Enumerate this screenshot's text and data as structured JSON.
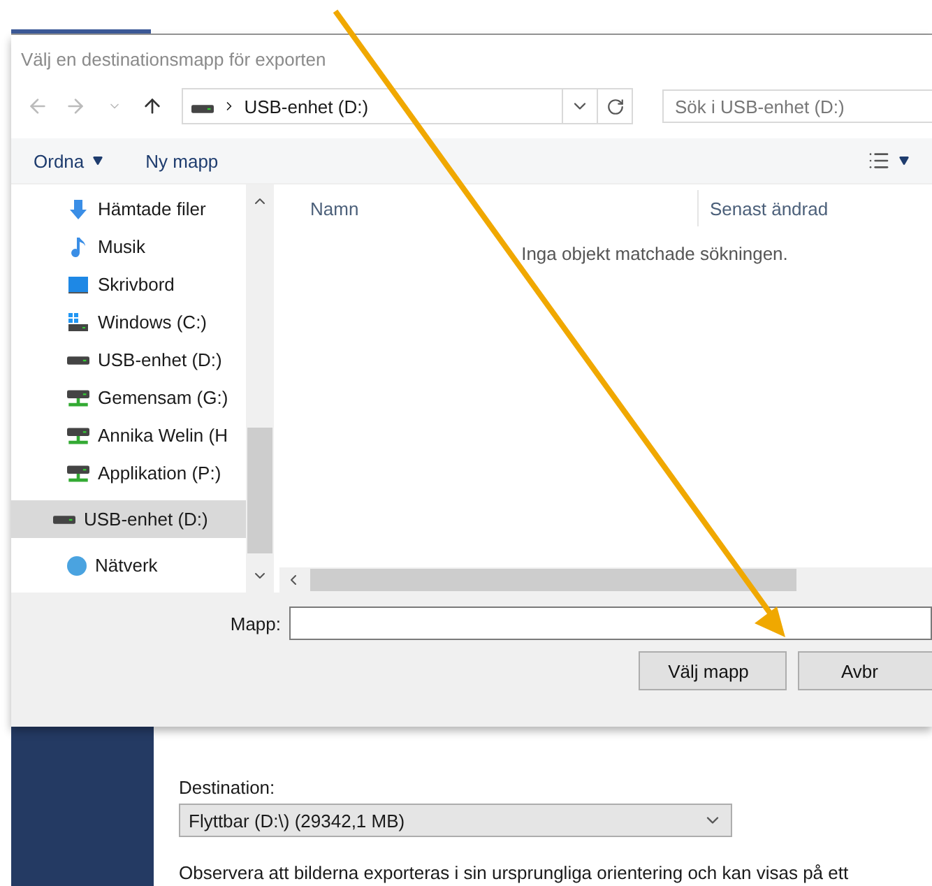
{
  "dialog": {
    "title": "Välj en destinationsmapp för exporten",
    "address": {
      "path": "USB-enhet (D:)"
    },
    "search": {
      "placeholder": "Sök i USB-enhet (D:)"
    },
    "toolbar": [
      "Ordna",
      "Ny mapp"
    ],
    "sidebar": {
      "items": [
        {
          "label": "Hämtade filer",
          "kind": "download",
          "selected": false
        },
        {
          "label": "Musik",
          "kind": "music",
          "selected": false
        },
        {
          "label": "Skrivbord",
          "kind": "desktop",
          "selected": false
        },
        {
          "label": "Windows (C:)",
          "kind": "system-drive",
          "selected": false
        },
        {
          "label": "USB-enhet (D:)",
          "kind": "drive",
          "selected": false
        },
        {
          "label": "Gemensam (G:)",
          "kind": "network-drive",
          "selected": false
        },
        {
          "label": "Annika Welin (H",
          "kind": "network-drive",
          "selected": false
        },
        {
          "label": "Applikation (P:)",
          "kind": "network-drive",
          "selected": false
        },
        {
          "label": "USB-enhet (D:)",
          "kind": "drive",
          "selected": true
        },
        {
          "label": "Nätverk",
          "kind": "network",
          "selected": false
        }
      ]
    },
    "columns": [
      "Namn",
      "Senast ändrad"
    ],
    "empty_message": "Inga objekt matchade sökningen.",
    "folder_field": {
      "label": "Mapp:"
    },
    "buttons": [
      "Välj mapp",
      "Avbr"
    ]
  },
  "background": {
    "destination_label": "Destination:",
    "destination_value": "Flyttbar (D:\\) (29342,1 MB)",
    "note": "Observera att bilderna exporteras i sin ursprungliga orientering och kan visas på ett"
  }
}
